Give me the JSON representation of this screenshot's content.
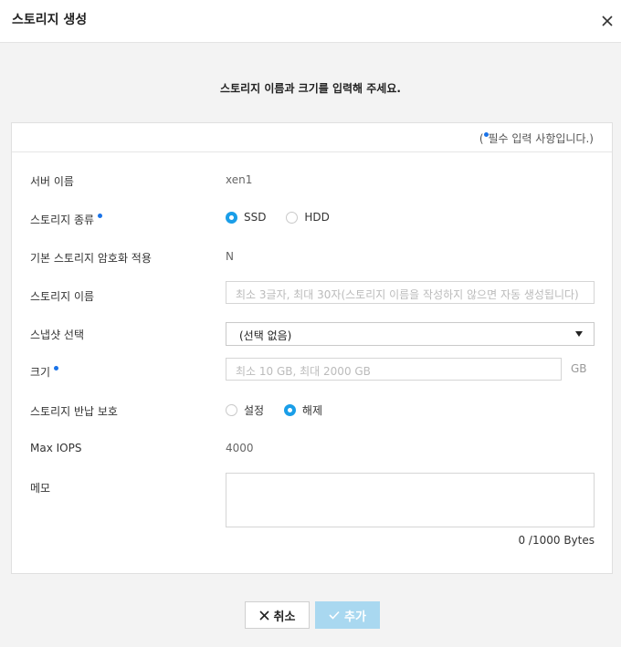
{
  "dialog": {
    "title": "스토리지 생성",
    "subtitle": "스토리지 이름과 크기를 입력해 주세요.",
    "required_note_open": "(",
    "required_note_text": "필수 입력 사항입니다.)"
  },
  "form": {
    "server_name": {
      "label": "서버 이름",
      "value": "xen1"
    },
    "storage_type": {
      "label": "스토리지 종류",
      "options": [
        "SSD",
        "HDD"
      ],
      "selected": "SSD"
    },
    "encryption": {
      "label": "기본 스토리지 암호화 적용",
      "value": "N"
    },
    "storage_name": {
      "label": "스토리지 이름",
      "placeholder": "최소 3글자, 최대 30자(스토리지 이름을 작성하지 않으면 자동 생성됩니다)"
    },
    "snapshot": {
      "label": "스냅샷 선택",
      "value": "(선택 없음)"
    },
    "size": {
      "label": "크기",
      "placeholder": "최소 10 GB, 최대 2000 GB",
      "unit": "GB"
    },
    "return_protection": {
      "label": "스토리지 반납 보호",
      "options": [
        "설정",
        "해제"
      ],
      "selected": "해제"
    },
    "max_iops": {
      "label": "Max IOPS",
      "value": "4000"
    },
    "memo": {
      "label": "메모",
      "counter": "0 /1000 Bytes"
    }
  },
  "buttons": {
    "cancel": "취소",
    "add": "추가"
  },
  "colors": {
    "accent": "#1a9ee8",
    "required_dot": "#1a73e8",
    "add_button_disabled": "#a9d8f0"
  },
  "icons": {
    "close": "close-icon",
    "cancel": "x-icon",
    "add": "check-icon",
    "select": "caret-down-icon"
  }
}
